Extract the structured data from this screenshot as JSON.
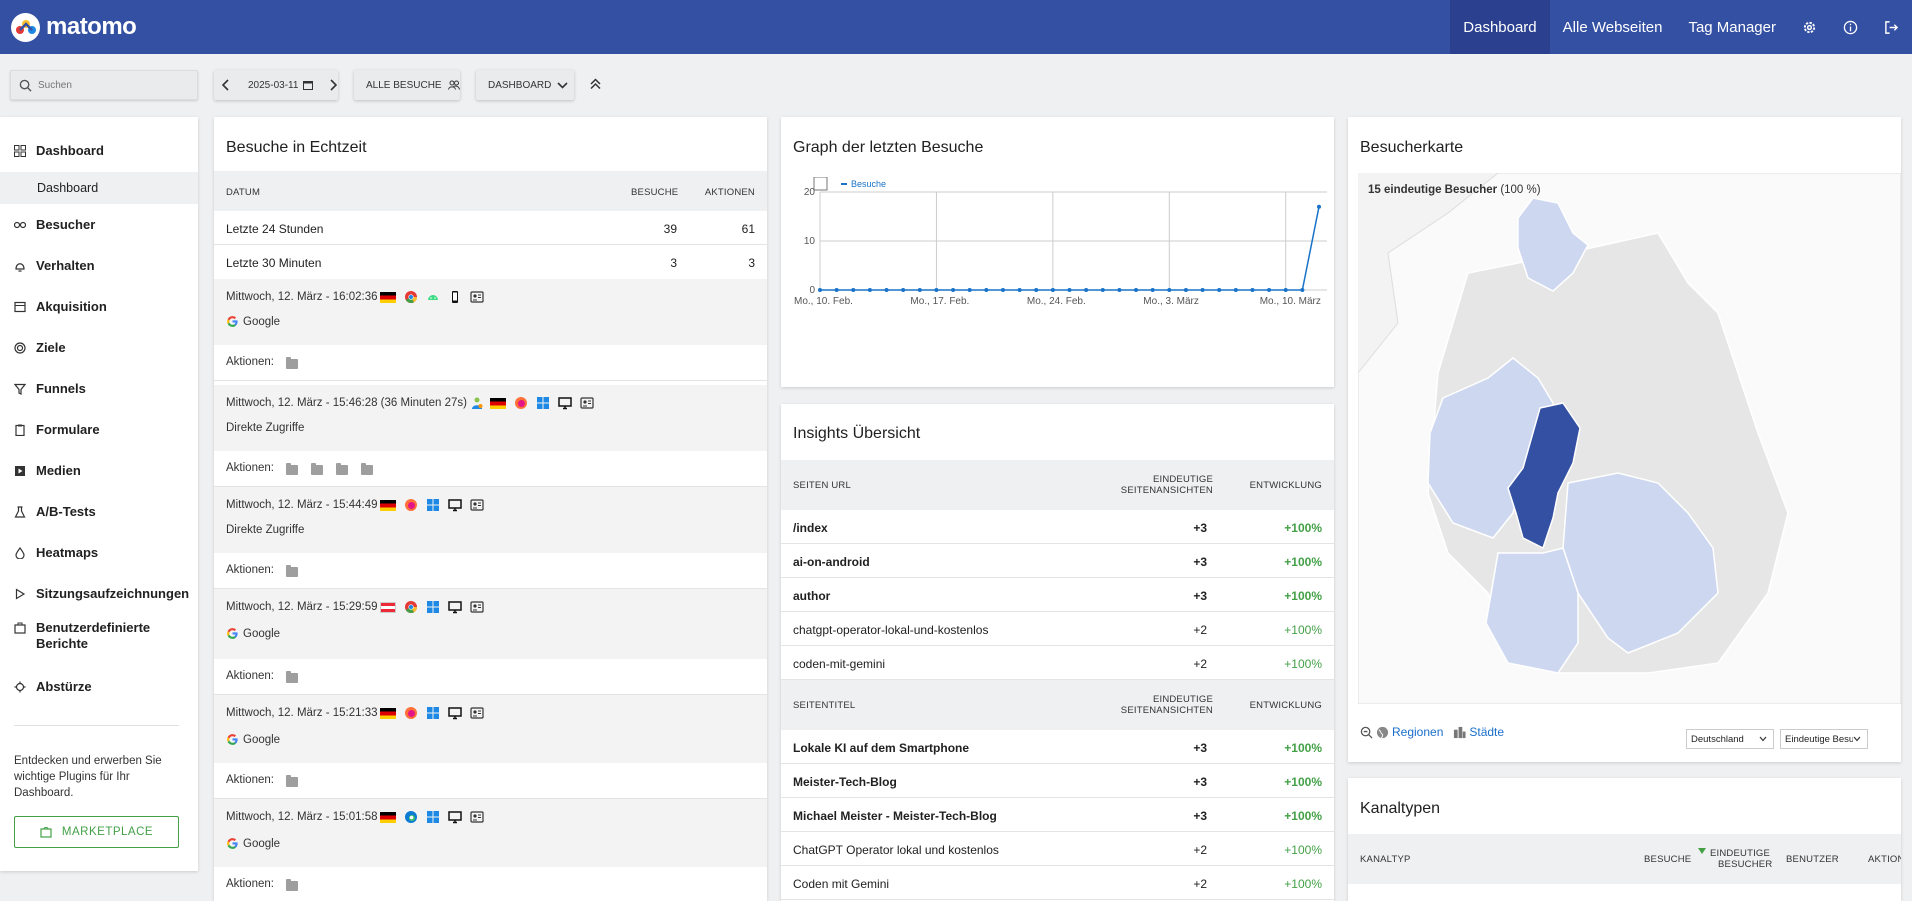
{
  "app": {
    "brand": "matomo"
  },
  "topnav": {
    "dashboard": "Dashboard",
    "all_websites": "Alle Webseiten",
    "tag_manager": "Tag Manager",
    "icons": [
      "gear-icon",
      "info-icon",
      "logout-icon"
    ]
  },
  "toolbar": {
    "search_placeholder": "Suchen",
    "date": "2025-03-11",
    "segment": "ALLE BESUCHE",
    "dashboard_menu": "DASHBOARD"
  },
  "sidebar": {
    "items": [
      {
        "label": "Dashboard",
        "icon": "dashboard-icon"
      },
      {
        "label": "Besucher",
        "icon": "visitors-icon"
      },
      {
        "label": "Verhalten",
        "icon": "behaviour-icon"
      },
      {
        "label": "Akquisition",
        "icon": "acquisition-icon"
      },
      {
        "label": "Ziele",
        "icon": "goals-icon"
      },
      {
        "label": "Funnels",
        "icon": "funnel-icon"
      },
      {
        "label": "Formulare",
        "icon": "forms-icon"
      },
      {
        "label": "Medien",
        "icon": "media-icon"
      },
      {
        "label": "A/B-Tests",
        "icon": "flask-icon"
      },
      {
        "label": "Heatmaps",
        "icon": "heatmap-icon"
      },
      {
        "label": "Sitzungsaufzeichnungen",
        "icon": "play-icon"
      },
      {
        "label": "Benutzerdefinierte Berichte",
        "icon": "reports-icon"
      },
      {
        "label": "Abstürze",
        "icon": "crash-icon"
      }
    ],
    "sub_item": "Dashboard",
    "promo": "Entdecken und erwerben Sie wichtige Plugins für Ihr Dashboard.",
    "marketplace": "MARKETPLACE"
  },
  "realtime": {
    "title": "Besuche in Echtzeit",
    "col_date": "DATUM",
    "col_visits": "BESUCHE",
    "col_actions": "AKTIONEN",
    "rows": [
      {
        "label": "Letzte 24 Stunden",
        "visits": "39",
        "actions": "61"
      },
      {
        "label": "Letzte 30 Minuten",
        "visits": "3",
        "actions": "3"
      }
    ],
    "actions_label": "Aktionen:",
    "visits": [
      {
        "time": "Mittwoch, 12. März - 16:02:36",
        "source": "Google",
        "folders": 1
      },
      {
        "time": "Mittwoch, 12. März - 15:46:28 (36 Minuten 27s)",
        "source": "Direkte Zugriffe",
        "folders": 4
      },
      {
        "time": "Mittwoch, 12. März - 15:44:49",
        "source": "Direkte Zugriffe",
        "folders": 1
      },
      {
        "time": "Mittwoch, 12. März - 15:29:59",
        "source": "Google",
        "folders": 1
      },
      {
        "time": "Mittwoch, 12. März - 15:21:33",
        "source": "Google",
        "folders": 1
      },
      {
        "time": "Mittwoch, 12. März - 15:01:58",
        "source": "Google",
        "folders": 1
      }
    ]
  },
  "graph": {
    "title": "Graph der letzten Besuche"
  },
  "chart_data": {
    "type": "line",
    "legend": "Besuche",
    "x_ticks": [
      "Mo., 10. Feb.",
      "Mo., 17. Feb.",
      "Mo., 24. Feb.",
      "Mo., 3. März",
      "Mo., 10. März"
    ],
    "y_ticks": [
      "0",
      "10",
      "20"
    ],
    "ylim": [
      0,
      20
    ],
    "series": [
      {
        "name": "Besuche",
        "values": [
          0,
          0,
          0,
          0,
          0,
          0,
          0,
          0,
          0,
          0,
          0,
          0,
          0,
          0,
          0,
          0,
          0,
          0,
          0,
          0,
          0,
          0,
          0,
          0,
          0,
          0,
          0,
          0,
          0,
          0,
          17
        ]
      }
    ],
    "color": "#1a73c8",
    "grid": true
  },
  "insights": {
    "title": "Insights Übersicht",
    "h1": {
      "col1": "SEITEN URL",
      "col2a": "EINDEUTIGE",
      "col2b": "SEITENANSICHTEN",
      "col3": "ENTWICKLUNG"
    },
    "rows1": [
      {
        "name": "/index",
        "value": "+3",
        "change": "+100%",
        "bold": true
      },
      {
        "name": "ai-on-android",
        "value": "+3",
        "change": "+100%",
        "bold": true
      },
      {
        "name": "author",
        "value": "+3",
        "change": "+100%",
        "bold": true
      },
      {
        "name": "chatgpt-operator-lokal-und-kostenlos",
        "value": "+2",
        "change": "+100%",
        "bold": false
      },
      {
        "name": "coden-mit-gemini",
        "value": "+2",
        "change": "+100%",
        "bold": false
      }
    ],
    "h2": {
      "col1": "SEITENTITEL",
      "col2a": "EINDEUTIGE",
      "col2b": "SEITENANSICHTEN",
      "col3": "ENTWICKLUNG"
    },
    "rows2": [
      {
        "name": "Lokale KI auf dem Smartphone",
        "value": "+3",
        "change": "+100%",
        "bold": true
      },
      {
        "name": "Meister-Tech-Blog",
        "value": "+3",
        "change": "+100%",
        "bold": true
      },
      {
        "name": "Michael Meister - Meister-Tech-Blog",
        "value": "+3",
        "change": "+100%",
        "bold": true
      },
      {
        "name": "ChatGPT Operator lokal und kostenlos",
        "value": "+2",
        "change": "+100%",
        "bold": false
      },
      {
        "name": "Coden mit Gemini",
        "value": "+2",
        "change": "+100%",
        "bold": false
      }
    ]
  },
  "map": {
    "title": "Besucherkarte",
    "summary_bold": "15 eindeutige Besucher",
    "summary_pct": "(100 %)",
    "regions_label": "Regionen",
    "cities_label": "Städte",
    "country_select": "Deutschland",
    "metric_select": "Eindeutige Besucher"
  },
  "channels": {
    "title": "Kanaltypen",
    "col_type": "KANALTYP",
    "col_visits": "BESUCHE",
    "col_unique_a": "EINDEUTIGE",
    "col_unique_b": "BESUCHER",
    "col_users": "BENUTZER",
    "col_actions": "AKTION"
  }
}
